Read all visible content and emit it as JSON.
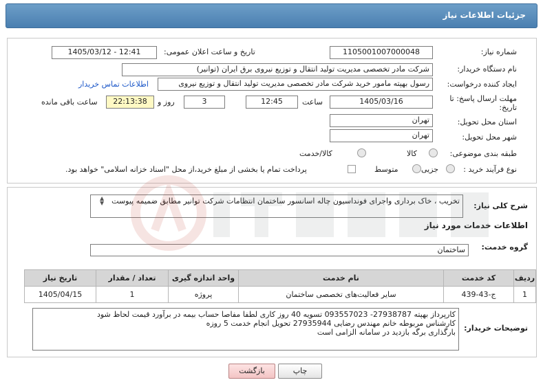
{
  "header": {
    "title": "جزئیات اطلاعات نیاز"
  },
  "fields": {
    "need_number_label": "شماره نیاز:",
    "need_number": "1105001007000048",
    "announce_label": "تاریخ و ساعت اعلان عمومی:",
    "announce_value": "1405/03/12 - 12:41",
    "buyer_label": "نام دستگاه خریدار:",
    "buyer_value": "شرکت مادر تخصصی مدیریت تولید  انتقال و توزیع نیروی برق ایران (توانیر)",
    "creator_label": "ایجاد کننده درخواست:",
    "creator_value": "رسول بهپته مامور خرید شرکت مادر تخصصی مدیریت تولید  انتقال و توزیع نیروی",
    "contact_link": "اطلاعات تماس خریدار",
    "deadline_label_line1": "مهلت ارسال پاسخ: تا",
    "deadline_label_line2": "تاریخ:",
    "deadline_date": "1405/03/16",
    "time_label": "ساعت",
    "deadline_time": "12:45",
    "days_value": "3",
    "days_label": "روز و",
    "remaining_time": "22:13:38",
    "remaining_label": "ساعت باقی مانده",
    "province_label": "استان محل تحویل:",
    "province_value": "تهران",
    "city_label": "شهر محل تحویل:",
    "city_value": "تهران",
    "category_label": "طبقه بندی موضوعی:",
    "category_options": [
      "کالا",
      "کالا/خدمت"
    ],
    "process_label": "نوع فرآیند خرید :",
    "process_options": [
      "جزیی",
      "متوسط"
    ],
    "payment_note": "پرداخت تمام یا بخشی از مبلغ خرید،از محل \"اسناد خزانه اسلامی\" خواهد بود."
  },
  "description": {
    "label": "شرح کلی نیاز:",
    "text": "تخریب ، خاک برداری واجرای فونداسیون چاله اسانسور  ساختمان انتظامات شرکت توانیر مطابق ضمیمه پیوست"
  },
  "services": {
    "section_title": "اطلاعات خدمات مورد نیاز",
    "group_label": "گروه خدمت:",
    "group_value": "ساختمان",
    "table": {
      "headers": [
        "ردیف",
        "کد خدمت",
        "نام خدمت",
        "واحد اندازه گیری",
        "تعداد / مقدار",
        "تاریخ نیاز"
      ],
      "rows": [
        [
          "1",
          "ج-43-439",
          "سایر فعالیت‌های تخصصی ساختمان",
          "پروژه",
          "1",
          "1405/04/15"
        ]
      ]
    }
  },
  "buyer_notes": {
    "label": "توضیحات خریدار:",
    "lines": [
      "کارپرداز بهپته 27938787- 093557023  تسویه 40 روز کاری  لطفا مفاصا حساب بیمه در برآورد قیمت لحاظ شود",
      "کارشناس مربوطه  خانم مهندس رضایی  27935944   تحویل انجام خدمت 5 روزه",
      "بارگذاری برگه بازدید در سامانه الزامی است"
    ]
  },
  "buttons": {
    "print": "چاپ",
    "back": "بازگشت"
  },
  "colors": {
    "header": "#5a8cbd",
    "link": "#1a56c8",
    "remaining_bg": "#fff9c4"
  }
}
